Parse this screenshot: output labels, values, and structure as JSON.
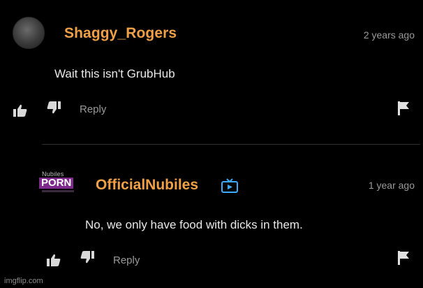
{
  "comments": [
    {
      "username": "Shaggy_Rogers",
      "timestamp": "2 years ago",
      "text": "Wait this isn't GrubHub",
      "reply_label": "Reply"
    },
    {
      "username": "OfficialNubiles",
      "brand_small": "Nubiles",
      "brand_big": "PORN",
      "timestamp": "1 year ago",
      "text": "No, we only have food with dicks in them.",
      "reply_label": "Reply"
    }
  ],
  "watermark": "imgflip.com",
  "colors": {
    "username": "#f0a047",
    "muted": "#9a9a9a",
    "text": "#e8e8e8",
    "brand": "#7e2a8c"
  },
  "icons": [
    "thumbs-up-icon",
    "thumbs-down-icon",
    "flag-icon",
    "channel-icon"
  ]
}
